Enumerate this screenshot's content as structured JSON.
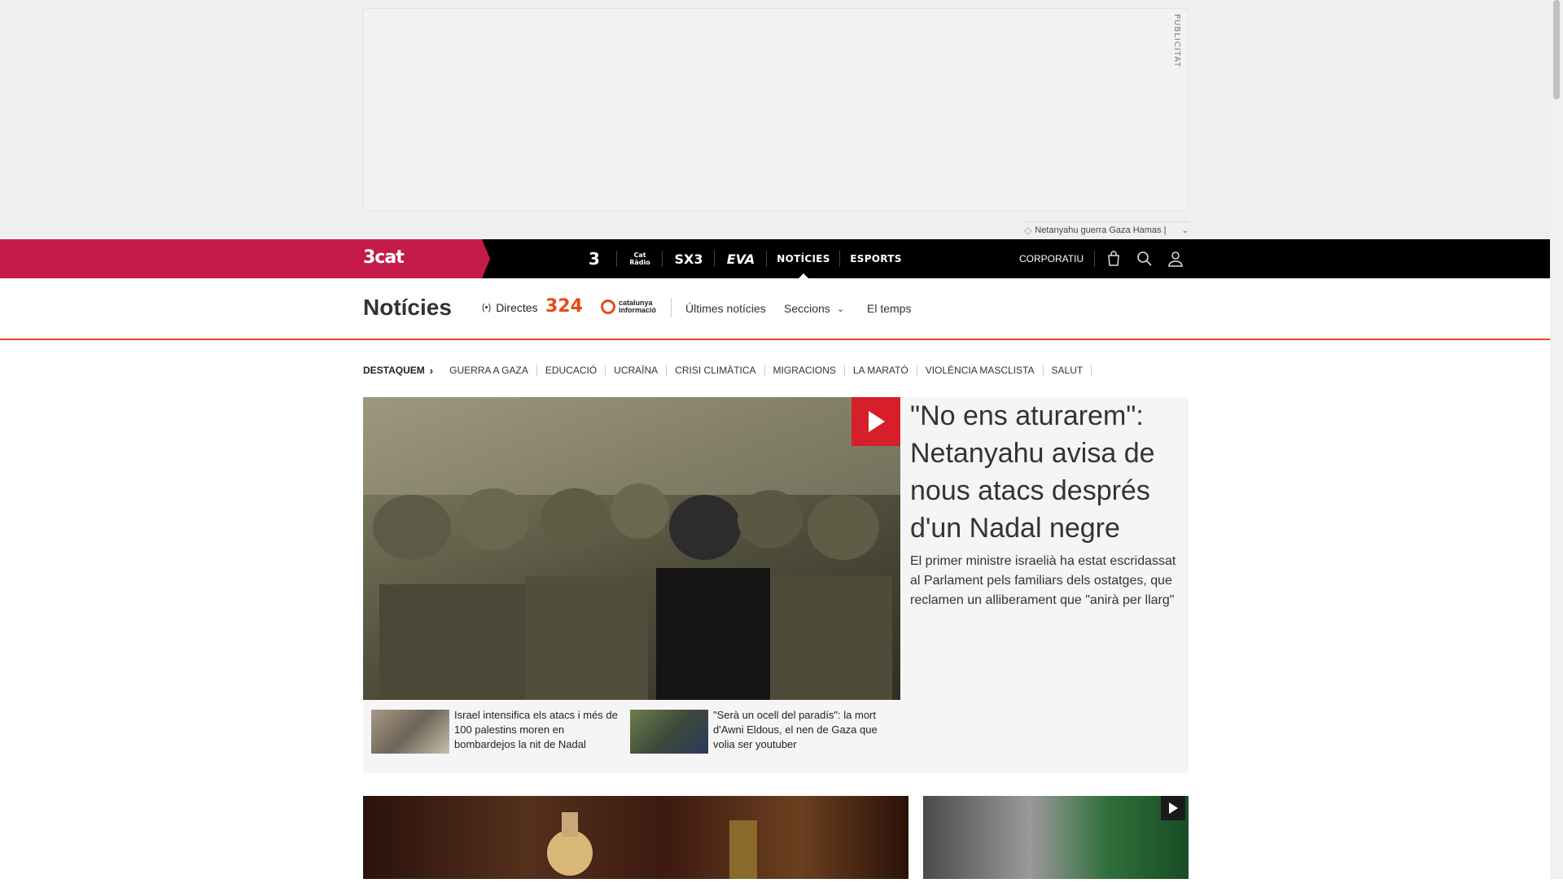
{
  "ad": {
    "label": "PUBLICITAT"
  },
  "tagline": {
    "text": "Netanyahu guerra Gaza Hamas |"
  },
  "topbar": {
    "logo": "3cat",
    "channels": [
      {
        "label": "3"
      },
      {
        "label": "Cat Ràdio"
      },
      {
        "label": "SX3"
      },
      {
        "label": "EVA"
      },
      {
        "label": "NOTÍCIES"
      },
      {
        "label": "ESPORTS"
      }
    ],
    "corporatiu": "CORPORATIU"
  },
  "section": {
    "title": "Notícies",
    "directes": "Directes",
    "logo_324": "324",
    "logo_ci_line1": "catalunya",
    "logo_ci_line2": "informació",
    "links": [
      "Últimes notícies",
      "Seccions",
      "El temps"
    ]
  },
  "destaquem": {
    "label": "DESTAQUEM",
    "tags": [
      "GUERRA A GAZA",
      "EDUCACIÓ",
      "UCRAÏNA",
      "CRISI CLIMÀTICA",
      "MIGRACIONS",
      "LA MARATÓ",
      "VIOLÈNCIA MASCLISTA",
      "SALUT"
    ]
  },
  "feature": {
    "headline": "\"No ens aturarem\": Netanyahu avisa de nous atacs després d'un Nadal negre",
    "lede": "El primer ministre israelià ha estat escridassat al Parlament pels familiars dels ostatges, que reclamen un alliberament que \"anirà per llarg\"",
    "related": [
      {
        "text": "Israel intensifica els atacs i més de 100 palestins moren en bombardejos la nit de Nadal"
      },
      {
        "text": "\"Serà un ocell del paradís\": la mort d'Awni Eldous, el nen de Gaza que volia ser youtuber"
      }
    ]
  },
  "colors": {
    "brand_red": "#c41b4b",
    "accent_orange": "#e64b16",
    "play_red": "#d61f2a"
  },
  "icons": [
    "shopping-bag-icon",
    "search-icon",
    "user-icon",
    "live-icon",
    "chevron-down-icon",
    "chevron-right-icon",
    "play-icon",
    "tag-icon"
  ]
}
